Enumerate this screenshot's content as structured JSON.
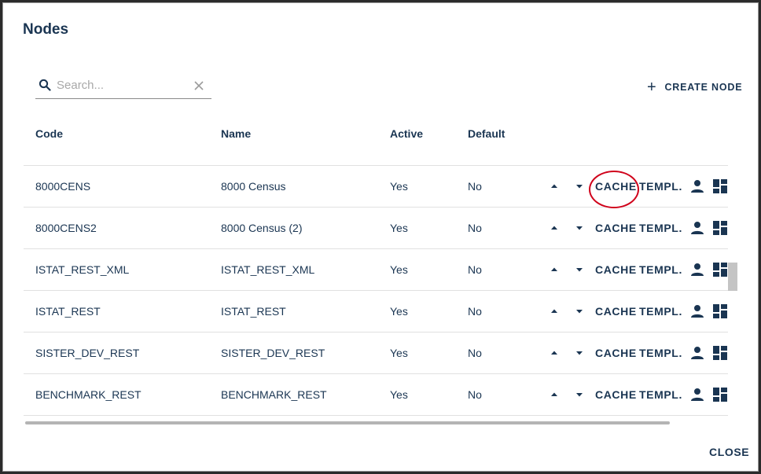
{
  "dialog": {
    "title": "Nodes"
  },
  "search": {
    "placeholder": "Search...",
    "value": ""
  },
  "toolbar": {
    "create_label": "CREATE NODE",
    "create_icon": "plus-icon"
  },
  "table": {
    "columns": [
      "Code",
      "Name",
      "Active",
      "Default"
    ],
    "rows": [
      {
        "code": "8000CENS",
        "name": "8000 Census",
        "active": "Yes",
        "default": "No",
        "cache": "CACHE",
        "templates": "TEMPL."
      },
      {
        "code": "8000CENS2",
        "name": "8000 Census (2)",
        "active": "Yes",
        "default": "No",
        "cache": "CACHE",
        "templates": "TEMPL."
      },
      {
        "code": "ISTAT_REST_XML",
        "name": "ISTAT_REST_XML",
        "active": "Yes",
        "default": "No",
        "cache": "CACHE",
        "templates": "TEMPL."
      },
      {
        "code": "ISTAT_REST",
        "name": "ISTAT_REST",
        "active": "Yes",
        "default": "No",
        "cache": "CACHE",
        "templates": "TEMPL."
      },
      {
        "code": "SISTER_DEV_REST",
        "name": "SISTER_DEV_REST",
        "active": "Yes",
        "default": "No",
        "cache": "CACHE",
        "templates": "TEMPL."
      },
      {
        "code": "BENCHMARK_REST",
        "name": "BENCHMARK_REST",
        "active": "Yes",
        "default": "No",
        "cache": "CACHE",
        "templates": "TEMPL."
      }
    ],
    "row_icons": [
      "arrow-up-icon",
      "arrow-down-icon",
      "user-icon",
      "dashboard-icon"
    ]
  },
  "footer": {
    "close_label": "CLOSE"
  },
  "colors": {
    "primary": "#1a3552",
    "highlight": "#d0021b",
    "divider": "#e1e1e1"
  }
}
